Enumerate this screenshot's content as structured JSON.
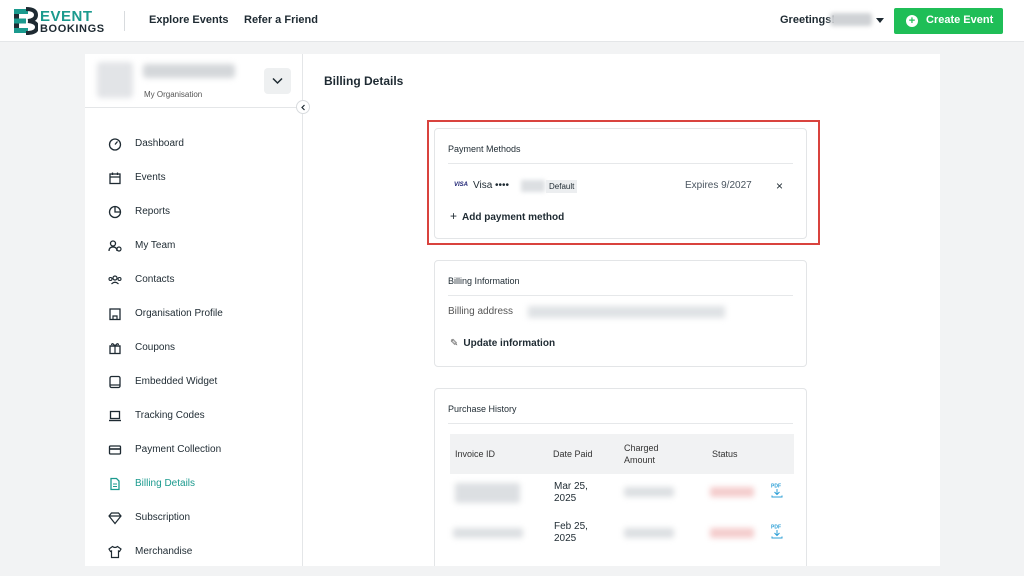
{
  "header": {
    "logo_line1": "EVENT",
    "logo_line2": "BOOKINGS",
    "nav": [
      "Explore Events",
      "Refer a Friend"
    ],
    "greeting": "Greetings!",
    "create_button": "Create Event"
  },
  "sidebar": {
    "org_sub": "My Organisation",
    "items": [
      {
        "label": "Dashboard",
        "icon": "gauge-icon"
      },
      {
        "label": "Events",
        "icon": "calendar-icon"
      },
      {
        "label": "Reports",
        "icon": "pie-chart-icon"
      },
      {
        "label": "My Team",
        "icon": "team-icon"
      },
      {
        "label": "Contacts",
        "icon": "contacts-icon"
      },
      {
        "label": "Organisation Profile",
        "icon": "building-icon"
      },
      {
        "label": "Coupons",
        "icon": "gift-icon"
      },
      {
        "label": "Embedded Widget",
        "icon": "widget-icon"
      },
      {
        "label": "Tracking Codes",
        "icon": "laptop-icon"
      },
      {
        "label": "Payment Collection",
        "icon": "card-icon"
      },
      {
        "label": "Billing Details",
        "icon": "document-icon",
        "active": true
      },
      {
        "label": "Subscription",
        "icon": "diamond-icon"
      },
      {
        "label": "Merchandise",
        "icon": "shirt-icon"
      }
    ]
  },
  "main": {
    "title": "Billing Details",
    "payment_methods": {
      "title": "Payment Methods",
      "card_badge": "VISA",
      "card_text": "Visa ••••",
      "default_label": "Default",
      "expires": "Expires 9/2027",
      "add_label": "Add payment method"
    },
    "billing_info": {
      "title": "Billing Information",
      "address_label": "Billing address",
      "update_label": "Update information"
    },
    "purchase_history": {
      "title": "Purchase History",
      "columns": [
        "Invoice ID",
        "Date Paid",
        "Charged Amount",
        "Status"
      ],
      "rows": [
        {
          "date": "Mar 25, 2025",
          "pdf": "PDF"
        },
        {
          "date": "Feb 25, 2025",
          "pdf": "PDF"
        }
      ]
    }
  },
  "colors": {
    "accent": "#1b9a8e",
    "create_button": "#1fbe57",
    "highlight": "#d9433e"
  }
}
